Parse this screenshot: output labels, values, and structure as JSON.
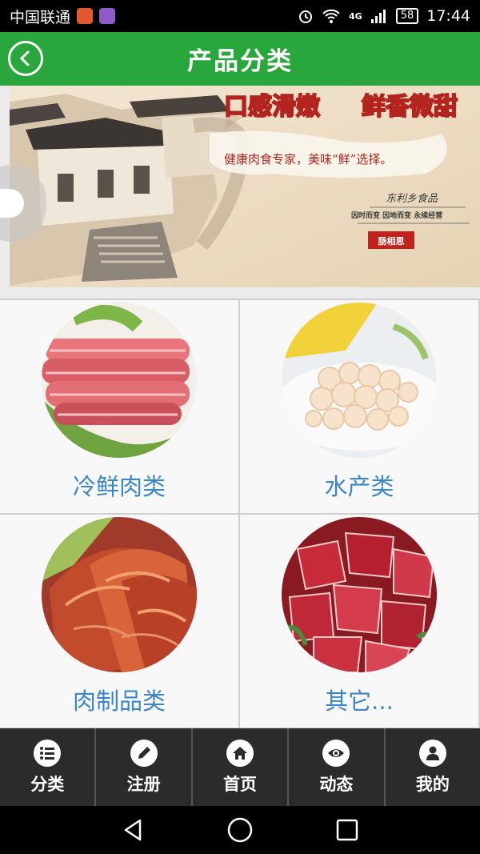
{
  "status_bar": {
    "carrier": "中国联通",
    "network": "4G",
    "battery": "58",
    "time": "17:44"
  },
  "header": {
    "title": "产品分类"
  },
  "banner": {
    "headline_left": "口感滑嫩",
    "headline_right": "鲜香微甜",
    "slogan": "健康肉食专家，美味“鲜”选择。",
    "brand": "东利乡食品",
    "brand_tagline": "因时而变  因地而变  永续经营",
    "seal": "肠相思"
  },
  "categories": [
    {
      "label": "冷鲜肉类"
    },
    {
      "label": "水产类"
    },
    {
      "label": "肉制品类"
    },
    {
      "label": "其它..."
    }
  ],
  "tabbar": {
    "items": [
      {
        "label": "分类",
        "icon": "list-icon"
      },
      {
        "label": "注册",
        "icon": "pencil-icon"
      },
      {
        "label": "首页",
        "icon": "home-icon"
      },
      {
        "label": "动态",
        "icon": "eye-icon"
      },
      {
        "label": "我的",
        "icon": "user-icon"
      }
    ]
  },
  "colors": {
    "header_green": "#2aa73c",
    "label_blue": "#3a86c8",
    "tabbar_bg": "#2b2b2b"
  }
}
